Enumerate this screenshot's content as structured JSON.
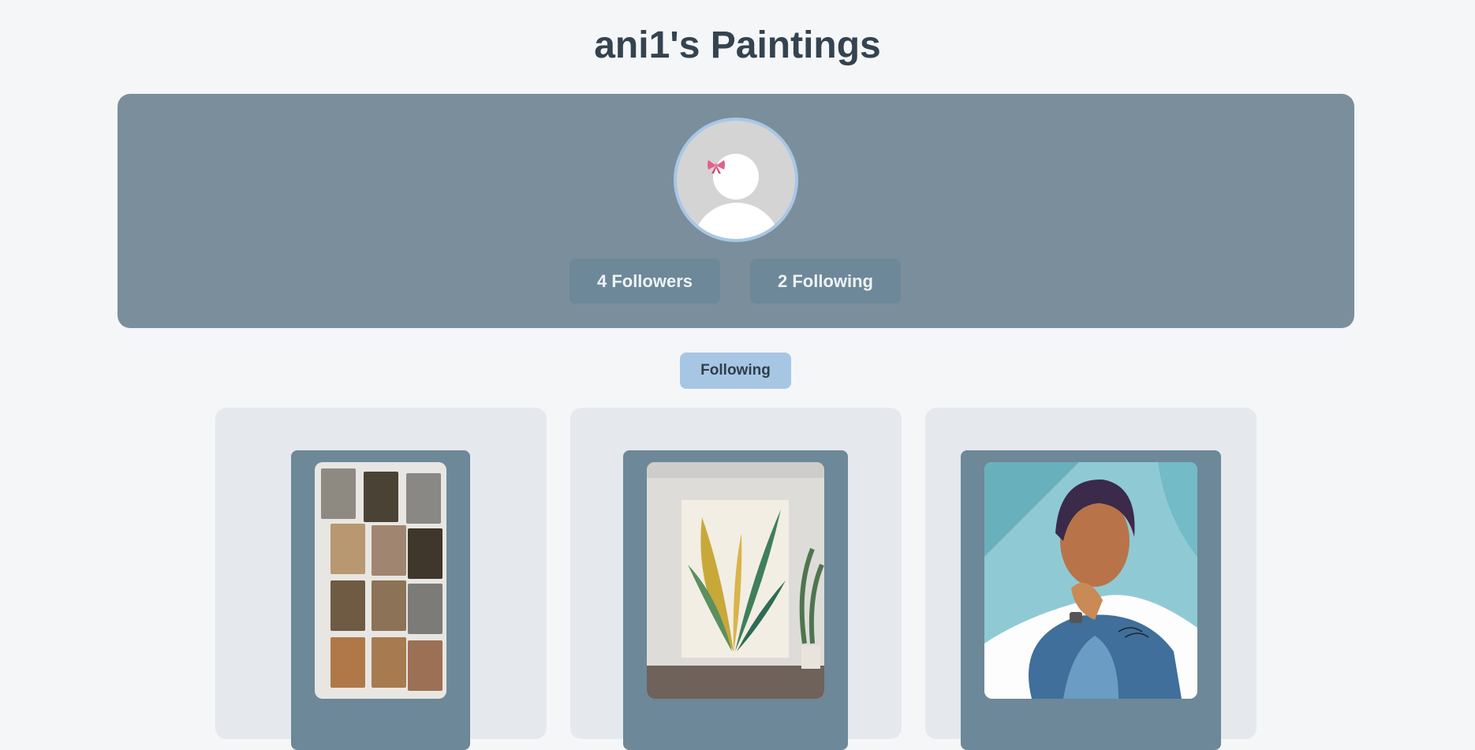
{
  "page": {
    "title": "ani1's Paintings"
  },
  "profile": {
    "avatar_icon": "user-avatar-with-bow-icon",
    "followers_label": "4 Followers",
    "following_label": "2 Following"
  },
  "toggle": {
    "label": "Following"
  },
  "paintings": [
    {
      "icon": "textured-tiles-artwork-image"
    },
    {
      "icon": "banana-leaf-canvas-image"
    },
    {
      "icon": "man-portrait-painting-image"
    }
  ],
  "colors": {
    "background": "#f4f6f8",
    "panel": "#7a8f9b",
    "stat_button": "#6d8898",
    "toggle_button": "#a7c6e4",
    "card": "#e5e8ec",
    "frame": "#6d8898",
    "avatar_border": "#a9c6e6"
  }
}
